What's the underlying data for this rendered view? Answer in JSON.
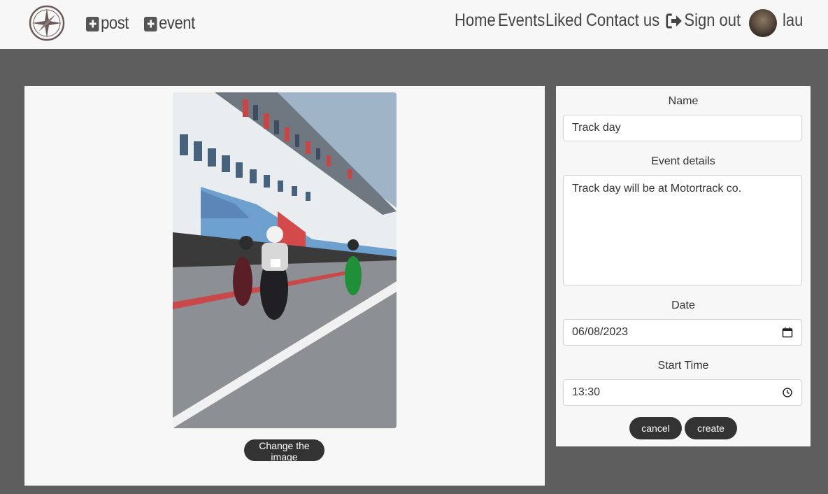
{
  "nav": {
    "add_post": "post",
    "add_event": "event",
    "links": [
      "Home",
      "Events",
      "Liked",
      "Contact us"
    ],
    "sign_out": "Sign out",
    "username": "lau"
  },
  "left": {
    "change_image_label": "Change the image"
  },
  "form": {
    "name_label": "Name",
    "name_value": "Track day",
    "details_label": "Event details",
    "details_value": "Track day will be at Motortrack co.",
    "date_label": "Date",
    "date_value": "06/08/2023",
    "time_label": "Start Time",
    "time_value": "13:30",
    "cancel_label": "cancel",
    "create_label": "create"
  }
}
